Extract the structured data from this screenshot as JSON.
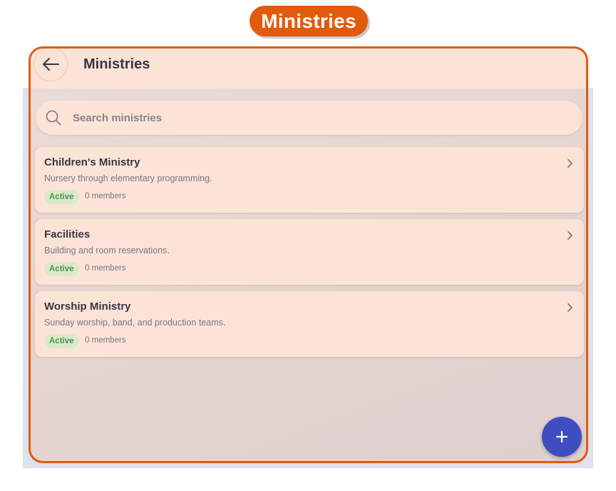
{
  "banner": {
    "label": "Ministries"
  },
  "app_bar": {
    "title": "Ministries",
    "back_icon": "arrow-left-icon"
  },
  "search": {
    "placeholder": "Search ministries",
    "value": ""
  },
  "ministries": [
    {
      "title": "Children's Ministry",
      "description": "Nursery through elementary programming.",
      "status": "Active",
      "members": "0 members"
    },
    {
      "title": "Facilities",
      "description": "Building and room reservations.",
      "status": "Active",
      "members": "0 members"
    },
    {
      "title": "Worship Ministry",
      "description": "Sunday worship, band, and production teams.",
      "status": "Active",
      "members": "0 members"
    }
  ],
  "fab": {
    "icon": "plus-icon"
  },
  "colors": {
    "accent": "#e25a0c",
    "surface": "#fbe4d6",
    "fab": "#3f4dc0",
    "badge_text": "#3f9d47",
    "badge_bg": "#dde7cc"
  }
}
